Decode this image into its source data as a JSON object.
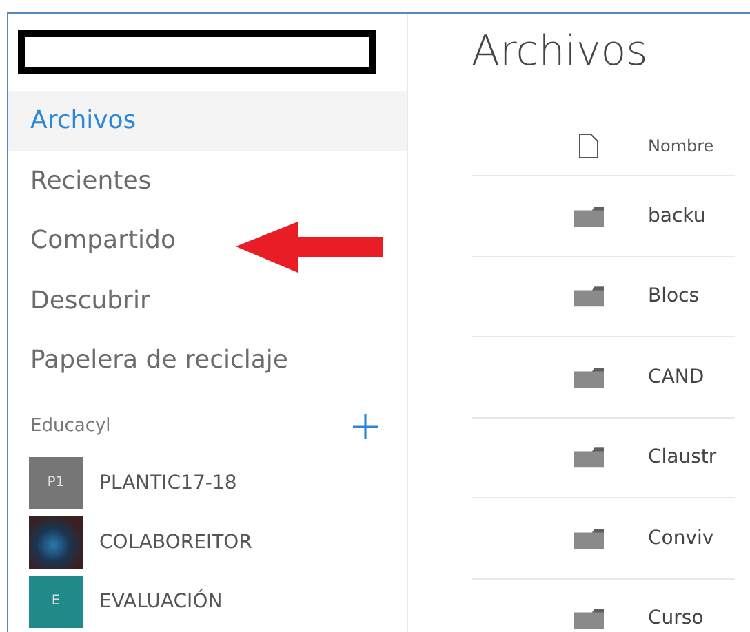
{
  "sidebar": {
    "nav": [
      {
        "label": "Archivos",
        "selected": true
      },
      {
        "label": "Recientes",
        "selected": false
      },
      {
        "label": "Compartido",
        "selected": false
      },
      {
        "label": "Descubrir",
        "selected": false
      },
      {
        "label": "Papelera de reciclaje",
        "selected": false
      }
    ],
    "section": {
      "title": "Educacyl",
      "groups": [
        {
          "kind": "initials",
          "badge": "P1",
          "name": "PLANTIC17-18",
          "color": "#767676"
        },
        {
          "kind": "photo",
          "name": "COLABOREITOR"
        },
        {
          "kind": "initials",
          "badge": "E",
          "name": "EVALUACIÓN",
          "color": "#1f8a87"
        }
      ]
    }
  },
  "main": {
    "title": "Archivos",
    "table": {
      "columns": [
        "Nombre"
      ],
      "rows": [
        {
          "name": "backu"
        },
        {
          "name": "Blocs"
        },
        {
          "name": "CAND"
        },
        {
          "name": "Claustr"
        },
        {
          "name": "Conviv"
        },
        {
          "name": "Curso"
        }
      ]
    }
  }
}
